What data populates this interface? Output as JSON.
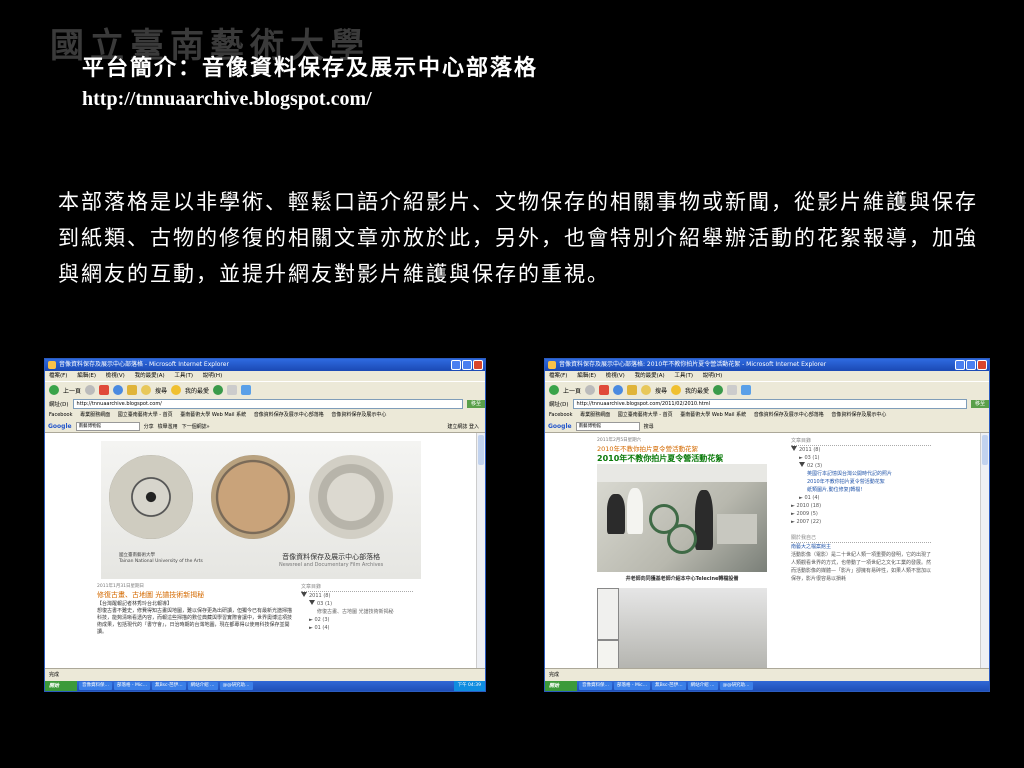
{
  "slide": {
    "watermark": "國立臺南藝術大學",
    "title": "平台簡介：音像資料保存及展示中心部落格",
    "url": "http://tnnuaarchive.blogspot.com/",
    "description": "本部落格是以非學術、輕鬆口語介紹影片、文物保存的相關事物或新聞，從影片維護與保存到紙類、古物的修復的相關文章亦放於此，另外，也會特別介紹舉辦活動的花絮報導，加強與網友的互動，並提升網友對影片維護與保存的重視。"
  },
  "browser": {
    "menu": [
      "檔案(F)",
      "編輯(E)",
      "檢視(V)",
      "我的最愛(A)",
      "工具(T)",
      "說明(H)"
    ],
    "back": "上一頁",
    "search": "搜尋",
    "favorites": "我的最愛",
    "address_label": "網址(D)",
    "go": "移至",
    "links": [
      "Facebook",
      "專業服務網面",
      "國立臺南藝術大學 - 首頁",
      "臺南藝術大學 Web Mail 系統",
      "音像資料保存及展示中心部落格",
      "音像資料保存及展示中心"
    ],
    "google": "Google",
    "google_query": "南藝博物館",
    "status": "完成",
    "taskbar": [
      "開始",
      "音像資料保…",
      "部落格 - Mic…",
      "無Bsc-芭伊…",
      "網站介紹 …",
      "@@研究助…"
    ]
  },
  "shot1": {
    "window_title": "音像資料保存及展示中心部落格 - Microsoft Internet Explorer",
    "address": "http://tnnuaarchive.blogspot.com/",
    "google_extra": [
      "分享",
      "檢舉濫用",
      "下一個網誌»"
    ],
    "login": "建立網誌  登入",
    "university_cn": "國立臺南藝術大學",
    "university_en": "Tainan National University of the Arts",
    "center_cn": "音像資料保存及展示中心部落格",
    "center_en": "Newsreel and Documentary Film Archives",
    "post_date": "2011年1月31日星期日",
    "post_title": "修復古畫、古地圖 光譜技術新揭秘",
    "post_tag": "【台灣醒報記者林秀玲台北報導】",
    "post_body": "想復古書不難史，修費得知古畫與地圖，難以保存更為出研讀，但獨今已有最新光譜掃描科技，能夠清晰看透內容，而報這些掃描的數位典藏與學習實際會讓中，世界奧博這項技術成果，包括現代的『書守會』，日治時期的台灣地圖，現在都專得以使用科技保存並開讀。",
    "side_header": "文章目錄",
    "side_items": [
      "2011 (8)",
      "03 (1)",
      "修復古畫、古地圖 光譜技術新揭秘",
      "02 (3)",
      "01 (4)"
    ],
    "clock": "下午 04:39"
  },
  "shot2": {
    "window_title": "音像資料保存及展示中心部落格: 2010年不教你拍片夏令營活動花絮 - Microsoft Internet Explorer",
    "address": "http://tnnuaarchive.blogspot.com/2011/02/2010.html",
    "post_date": "2011年2月5日星期六",
    "title_small": "2010年不教你拍片夏令營活動花絮",
    "title_big": "2010年不教你拍片夏令營活動花絮",
    "caption": "井老師向同獲基老師介紹本中心Telecine轉檔設備",
    "side_header": "文章目錄",
    "side_items": [
      "2011 (8)",
      "03 (1)",
      "02 (3)"
    ],
    "side_links": [
      "英國行本記憶與台灣公開時代記的照片",
      "2010年不教你拍片夏令營活動花絮",
      "紙類圖片,動位修复|轉檔!"
    ],
    "side_more": [
      "01 (4)",
      "2010 (18)",
      "2009 (5)",
      "2007 (22)"
    ],
    "about_header": "關於我自己",
    "about_name": "南藝大之檔案館主",
    "about_body": "活動影像（電影）是二十世紀人類一項重要的發明，它的出現了人類觀看世界的方式，也帶動了一項世紀之文化工業的發展。然而活動影像的媒體—「影片」卻擁有易碎性，如果人類不當加以保存，影片很容易以損耗"
  }
}
